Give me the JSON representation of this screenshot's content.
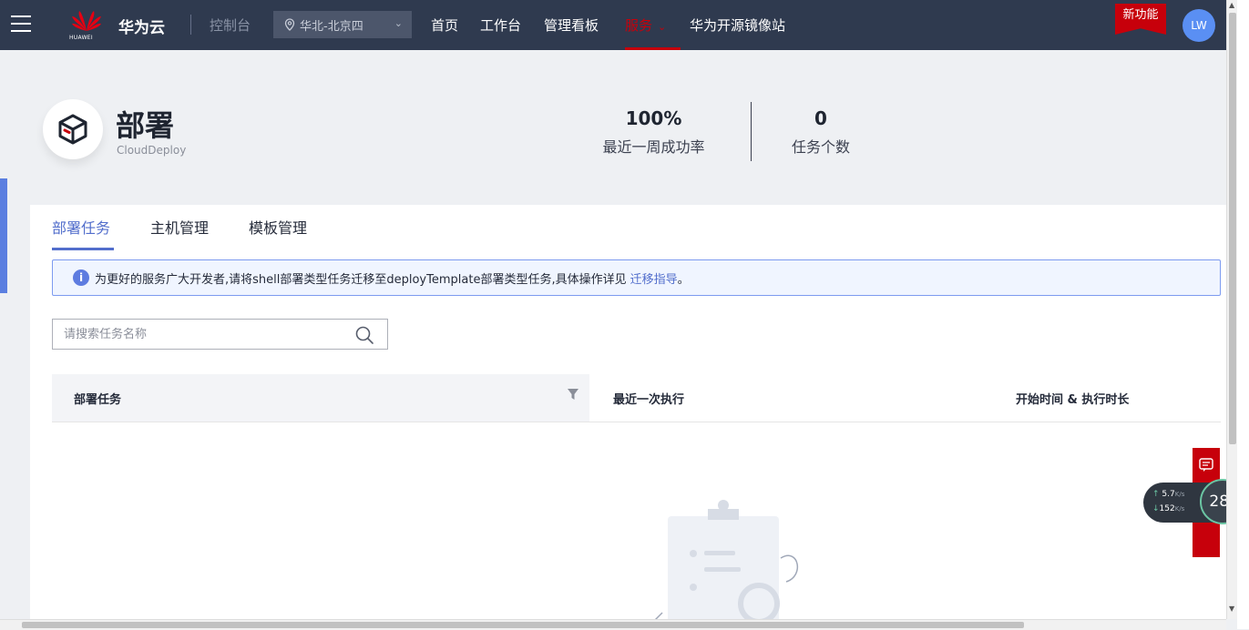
{
  "nav": {
    "brand": "华为云",
    "logo_text": "HUAWEI",
    "console": "控制台",
    "region": "华北-北京四",
    "links": [
      "首页",
      "工作台",
      "管理看板",
      "服务",
      "华为开源镜像站"
    ],
    "new_feature": "新功能",
    "avatar": "LW"
  },
  "header": {
    "title": "部署",
    "subtitle": "CloudDeploy",
    "stats": [
      {
        "value": "100%",
        "label": "最近一周成功率"
      },
      {
        "value": "0",
        "label": "任务个数"
      }
    ]
  },
  "tabs": [
    "部署任务",
    "主机管理",
    "模板管理"
  ],
  "notice": {
    "text": "为更好的服务广大开发者,请将shell部署类型任务迁移至deployTemplate部署类型任务,具体操作详见",
    "link": "迁移指导",
    "tail": "。"
  },
  "search": {
    "placeholder": "请搜索任务名称"
  },
  "table": {
    "columns": [
      "部署任务",
      "最近一次执行",
      "开始时间 & 执行时长"
    ]
  },
  "network": {
    "up": "5.7",
    "down": "152",
    "unit": "K/s",
    "percent": "28",
    "percent_unit": "%"
  },
  "colors": {
    "nav_bg": "#2f3a4f",
    "accent": "#526ecc",
    "brand_red": "#c7000b"
  }
}
